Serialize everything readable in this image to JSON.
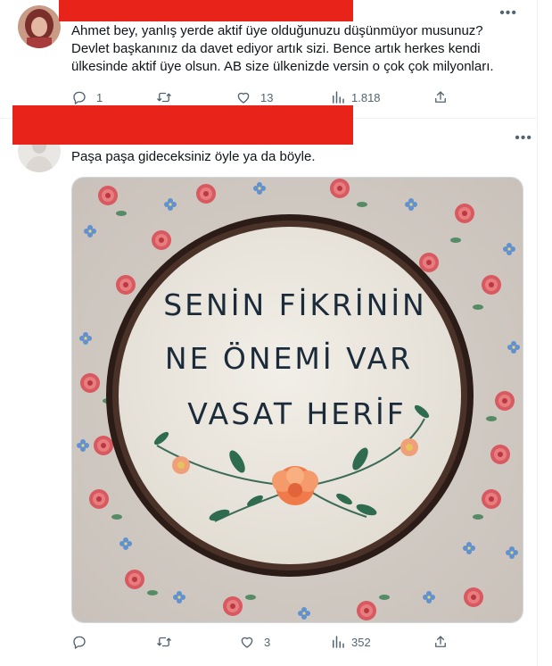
{
  "tweet1": {
    "text": "Ahmet bey, yanlış yerde aktif üye olduğunuzu düşünmüyor musunuz? Devlet başkanınız da davet ediyor artık sizi. Bence artık herkes kendi ülkesinde aktif üye olsun. AB size ülkenizde versin o çok çok milyonları.",
    "more": "•••",
    "replies": "1",
    "retweets": "",
    "likes": "13",
    "views": "1.818"
  },
  "tweet2": {
    "text": "Paşa paşa gideceksiniz öyle ya da böyle.",
    "more": "•••",
    "replies": "",
    "retweets": "",
    "likes": "3",
    "views": "352",
    "image_text": {
      "line1": "SENİN FİKRİNİN",
      "line2": "NE ÖNEMİ VAR",
      "line3": "VASAT HERİF"
    }
  },
  "colors": {
    "redaction": "#e8241a",
    "text": "#0f1419",
    "muted": "#536471",
    "divider": "#eff3f4",
    "hoop": "#3b2a22",
    "fabric": "#ebe7df",
    "thread": "#1c2b3a"
  },
  "icons": [
    "reply-icon",
    "retweet-icon",
    "like-icon",
    "views-icon",
    "share-icon",
    "more-icon"
  ]
}
